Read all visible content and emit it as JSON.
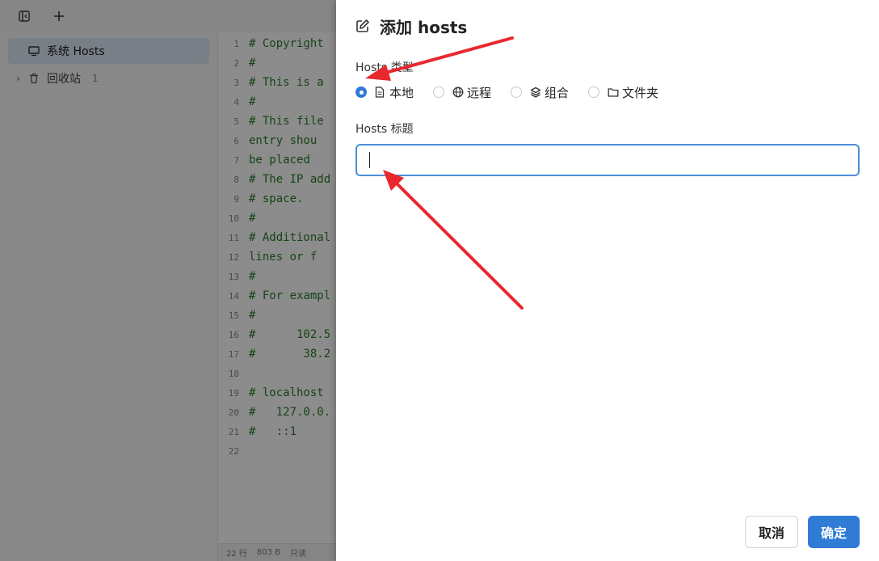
{
  "sidebar": {
    "items": [
      {
        "label": "系统 Hosts",
        "icon": "monitor-icon"
      },
      {
        "label": "回收站",
        "count": "1",
        "icon": "trash-icon"
      }
    ]
  },
  "editor": {
    "lines": [
      {
        "n": "1",
        "text": "# Copyright"
      },
      {
        "n": "2",
        "text": "#"
      },
      {
        "n": "3",
        "text": "# This is a"
      },
      {
        "n": "4",
        "text": "#"
      },
      {
        "n": "5",
        "text": "# This file"
      },
      {
        "n": "6",
        "text": "entry shou"
      },
      {
        "n": "7",
        "text": "be placed"
      },
      {
        "n": "8",
        "text": "# The IP add"
      },
      {
        "n": "9",
        "text": "# space."
      },
      {
        "n": "10",
        "text": "#"
      },
      {
        "n": "11",
        "text": "# Additional"
      },
      {
        "n": "12",
        "text": "lines or f"
      },
      {
        "n": "13",
        "text": "#"
      },
      {
        "n": "14",
        "text": "# For exampl"
      },
      {
        "n": "15",
        "text": "#"
      },
      {
        "n": "16",
        "text": "#      102.5"
      },
      {
        "n": "17",
        "text": "#       38.2"
      },
      {
        "n": "18",
        "text": ""
      },
      {
        "n": "19",
        "text": "# localhost"
      },
      {
        "n": "20",
        "text": "#   127.0.0."
      },
      {
        "n": "21",
        "text": "#   ::1"
      },
      {
        "n": "22",
        "text": ""
      }
    ],
    "status": {
      "lines": "22 行",
      "size": "803 B",
      "mode": "只读"
    }
  },
  "dialog": {
    "title": "添加 hosts",
    "type_label": "Hosts 类型",
    "types": [
      {
        "label": "本地",
        "icon": "file-icon",
        "checked": true
      },
      {
        "label": "远程",
        "icon": "globe-icon",
        "checked": false
      },
      {
        "label": "组合",
        "icon": "layers-icon",
        "checked": false
      },
      {
        "label": "文件夹",
        "icon": "folder-icon",
        "checked": false
      }
    ],
    "title_label": "Hosts 标题",
    "title_value": "",
    "cancel_label": "取消",
    "ok_label": "确定"
  },
  "colors": {
    "accent": "#2f7bd6",
    "annotation": "#e8282e",
    "code": "#2a7d2a"
  }
}
